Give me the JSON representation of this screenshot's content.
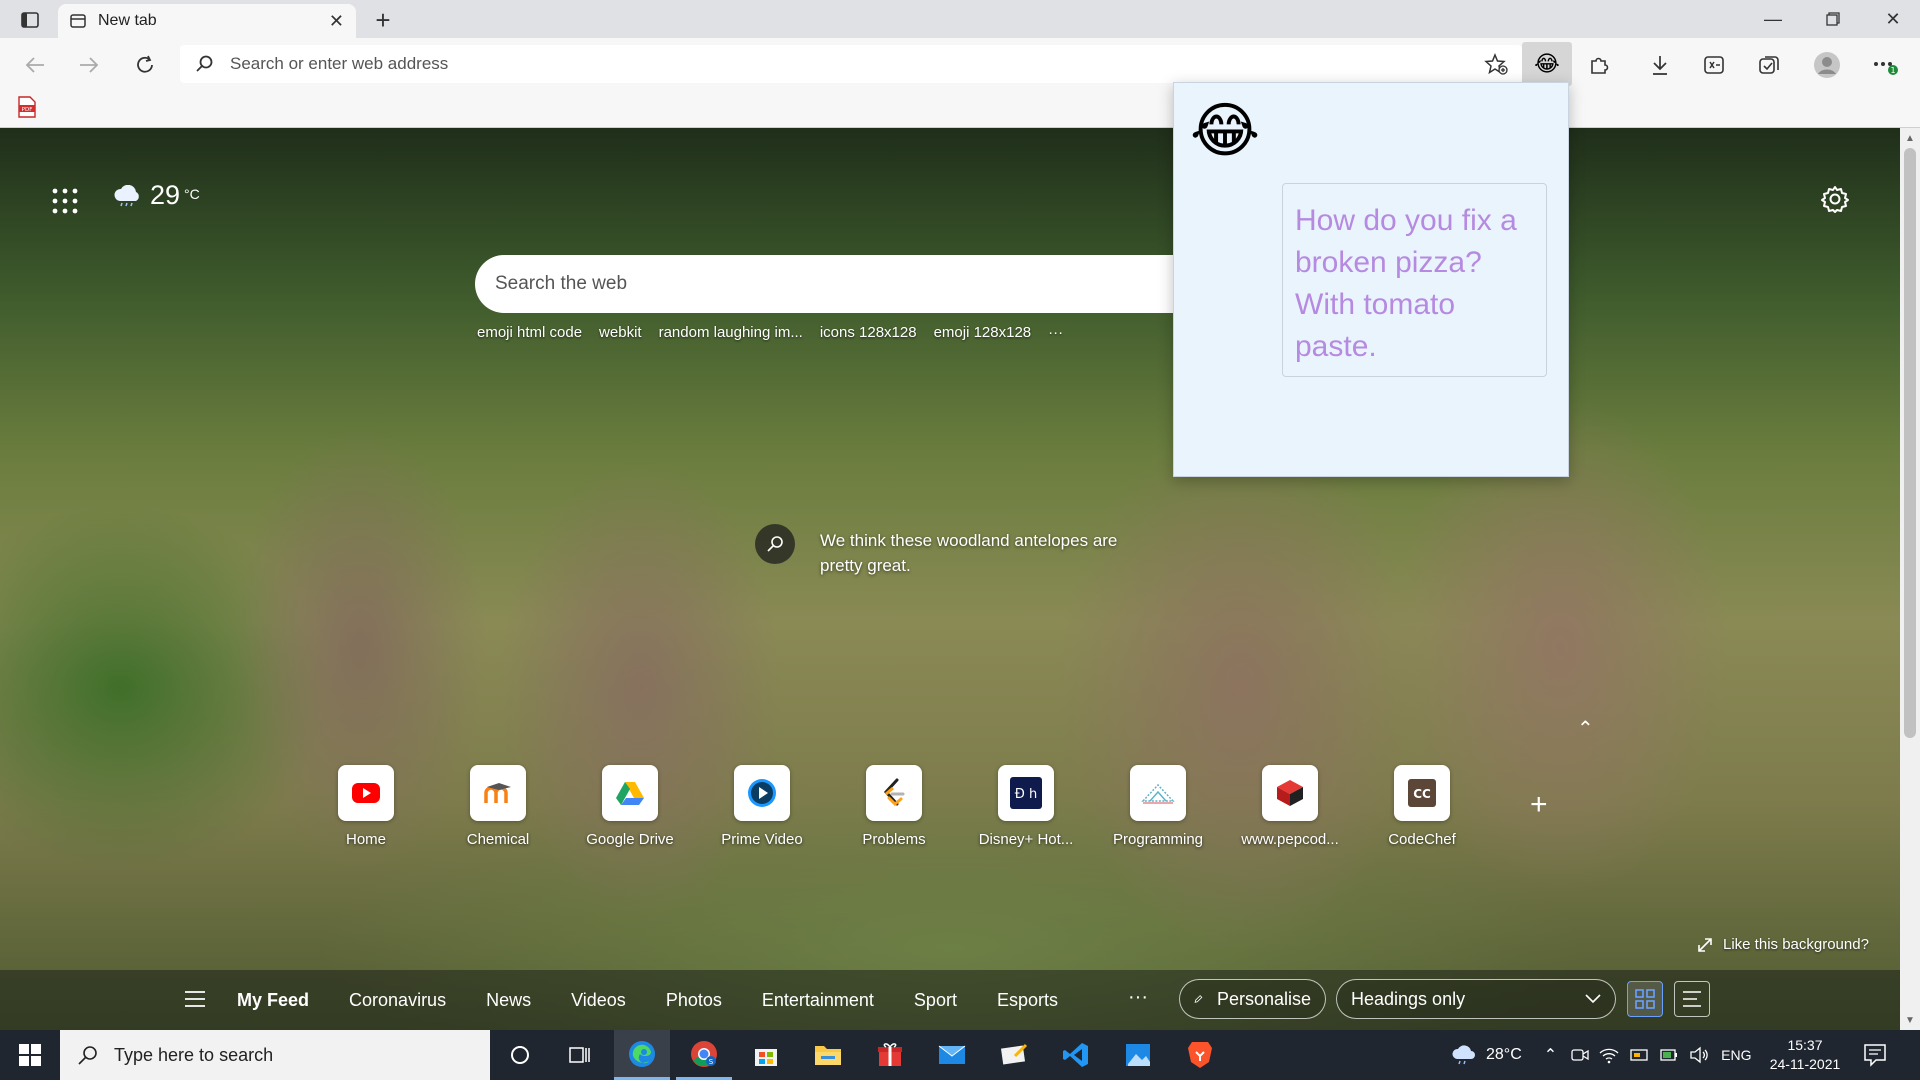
{
  "browser": {
    "tab_title": "New tab",
    "address_placeholder": "Search or enter web address"
  },
  "newtab": {
    "weather": {
      "temp": "29",
      "unit": "°C"
    },
    "search_placeholder": "Search the web",
    "suggestions": [
      "emoji html code",
      "webkit",
      "random laughing im...",
      "icons 128x128",
      "emoji 128x128",
      "···"
    ],
    "image_info": "We think these woodland antelopes are pretty great.",
    "like_background": "Like this background?",
    "quicklinks": [
      {
        "label": "Home",
        "icon": "youtube-icon",
        "color": "#ff0000"
      },
      {
        "label": "Chemical",
        "icon": "moodle-icon",
        "color": "#f98012"
      },
      {
        "label": "Google Drive",
        "icon": "google-drive-icon",
        "color": "#1fa463"
      },
      {
        "label": "Prime Video",
        "icon": "prime-video-icon",
        "color": "#1a98ff"
      },
      {
        "label": "Problems",
        "icon": "leetcode-icon",
        "color": "#ffa116"
      },
      {
        "label": "Disney+ Hot...",
        "icon": "disney-hotstar-icon",
        "color": "#0f1b4c"
      },
      {
        "label": "Programming",
        "icon": "programming-icon",
        "color": "#5fb3c9"
      },
      {
        "label": "www.pepcod...",
        "icon": "pepcoding-icon",
        "color": "#d9262b"
      },
      {
        "label": "CodeChef",
        "icon": "codechef-icon",
        "color": "#5b4638"
      }
    ]
  },
  "feed": {
    "tabs": [
      "My Feed",
      "Coronavirus",
      "News",
      "Videos",
      "Photos",
      "Entertainment",
      "Sport",
      "Esports"
    ],
    "more": "···",
    "personalise": "Personalise",
    "view_select": "Headings only"
  },
  "popup": {
    "emoji": "😂",
    "joke": "How do you fix a broken pizza? With tomato paste."
  },
  "taskbar": {
    "search_placeholder": "Type here to search",
    "weather_temp": "28°C",
    "language": "ENG",
    "time": "15:37",
    "date": "24-11-2021"
  }
}
